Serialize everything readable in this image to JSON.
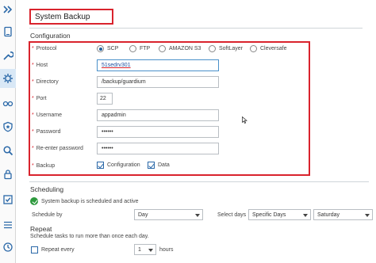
{
  "page": {
    "title": "System Backup"
  },
  "configuration": {
    "heading": "Configuration",
    "protocol": {
      "label": "Protocol",
      "options": [
        "SCP",
        "FTP",
        "AMAZON S3",
        "SoftLayer",
        "Cleversafe"
      ],
      "selected": "SCP"
    },
    "host": {
      "label": "Host",
      "value": "51sedrv301"
    },
    "directory": {
      "label": "Directory",
      "value": "/backup/guardium"
    },
    "port": {
      "label": "Port",
      "value": "22"
    },
    "username": {
      "label": "Username",
      "value": "appadmin"
    },
    "password": {
      "label": "Password",
      "value": "••••••"
    },
    "reenter_password": {
      "label": "Re-enter password",
      "value": "••••••"
    },
    "backup": {
      "label": "Backup",
      "options": [
        {
          "label": "Configuration",
          "checked": true
        },
        {
          "label": "Data",
          "checked": true
        }
      ]
    }
  },
  "scheduling": {
    "heading": "Scheduling",
    "status_text": "System backup is scheduled and active",
    "schedule_by_label": "Schedule by",
    "schedule_by_value": "Day",
    "select_days_label": "Select days",
    "select_days_value": "Specific Days",
    "day_value": "Saturday"
  },
  "repeat": {
    "heading": "Repeat",
    "description": "Schedule tasks to run more than once each day.",
    "repeat_every_label": "Repeat every",
    "repeat_value": "1",
    "unit_label": "hours"
  },
  "colors": {
    "accent": "#1f5f9c",
    "highlight_border": "#d9232d",
    "success": "#2e9a3e"
  },
  "sidebar": {
    "icons": [
      "expand-icon",
      "tablet-icon",
      "wrench-icon",
      "gear-icon",
      "glasses-icon",
      "shield-icon",
      "search-icon",
      "lock-icon",
      "checklist-icon",
      "clock-icon"
    ]
  }
}
